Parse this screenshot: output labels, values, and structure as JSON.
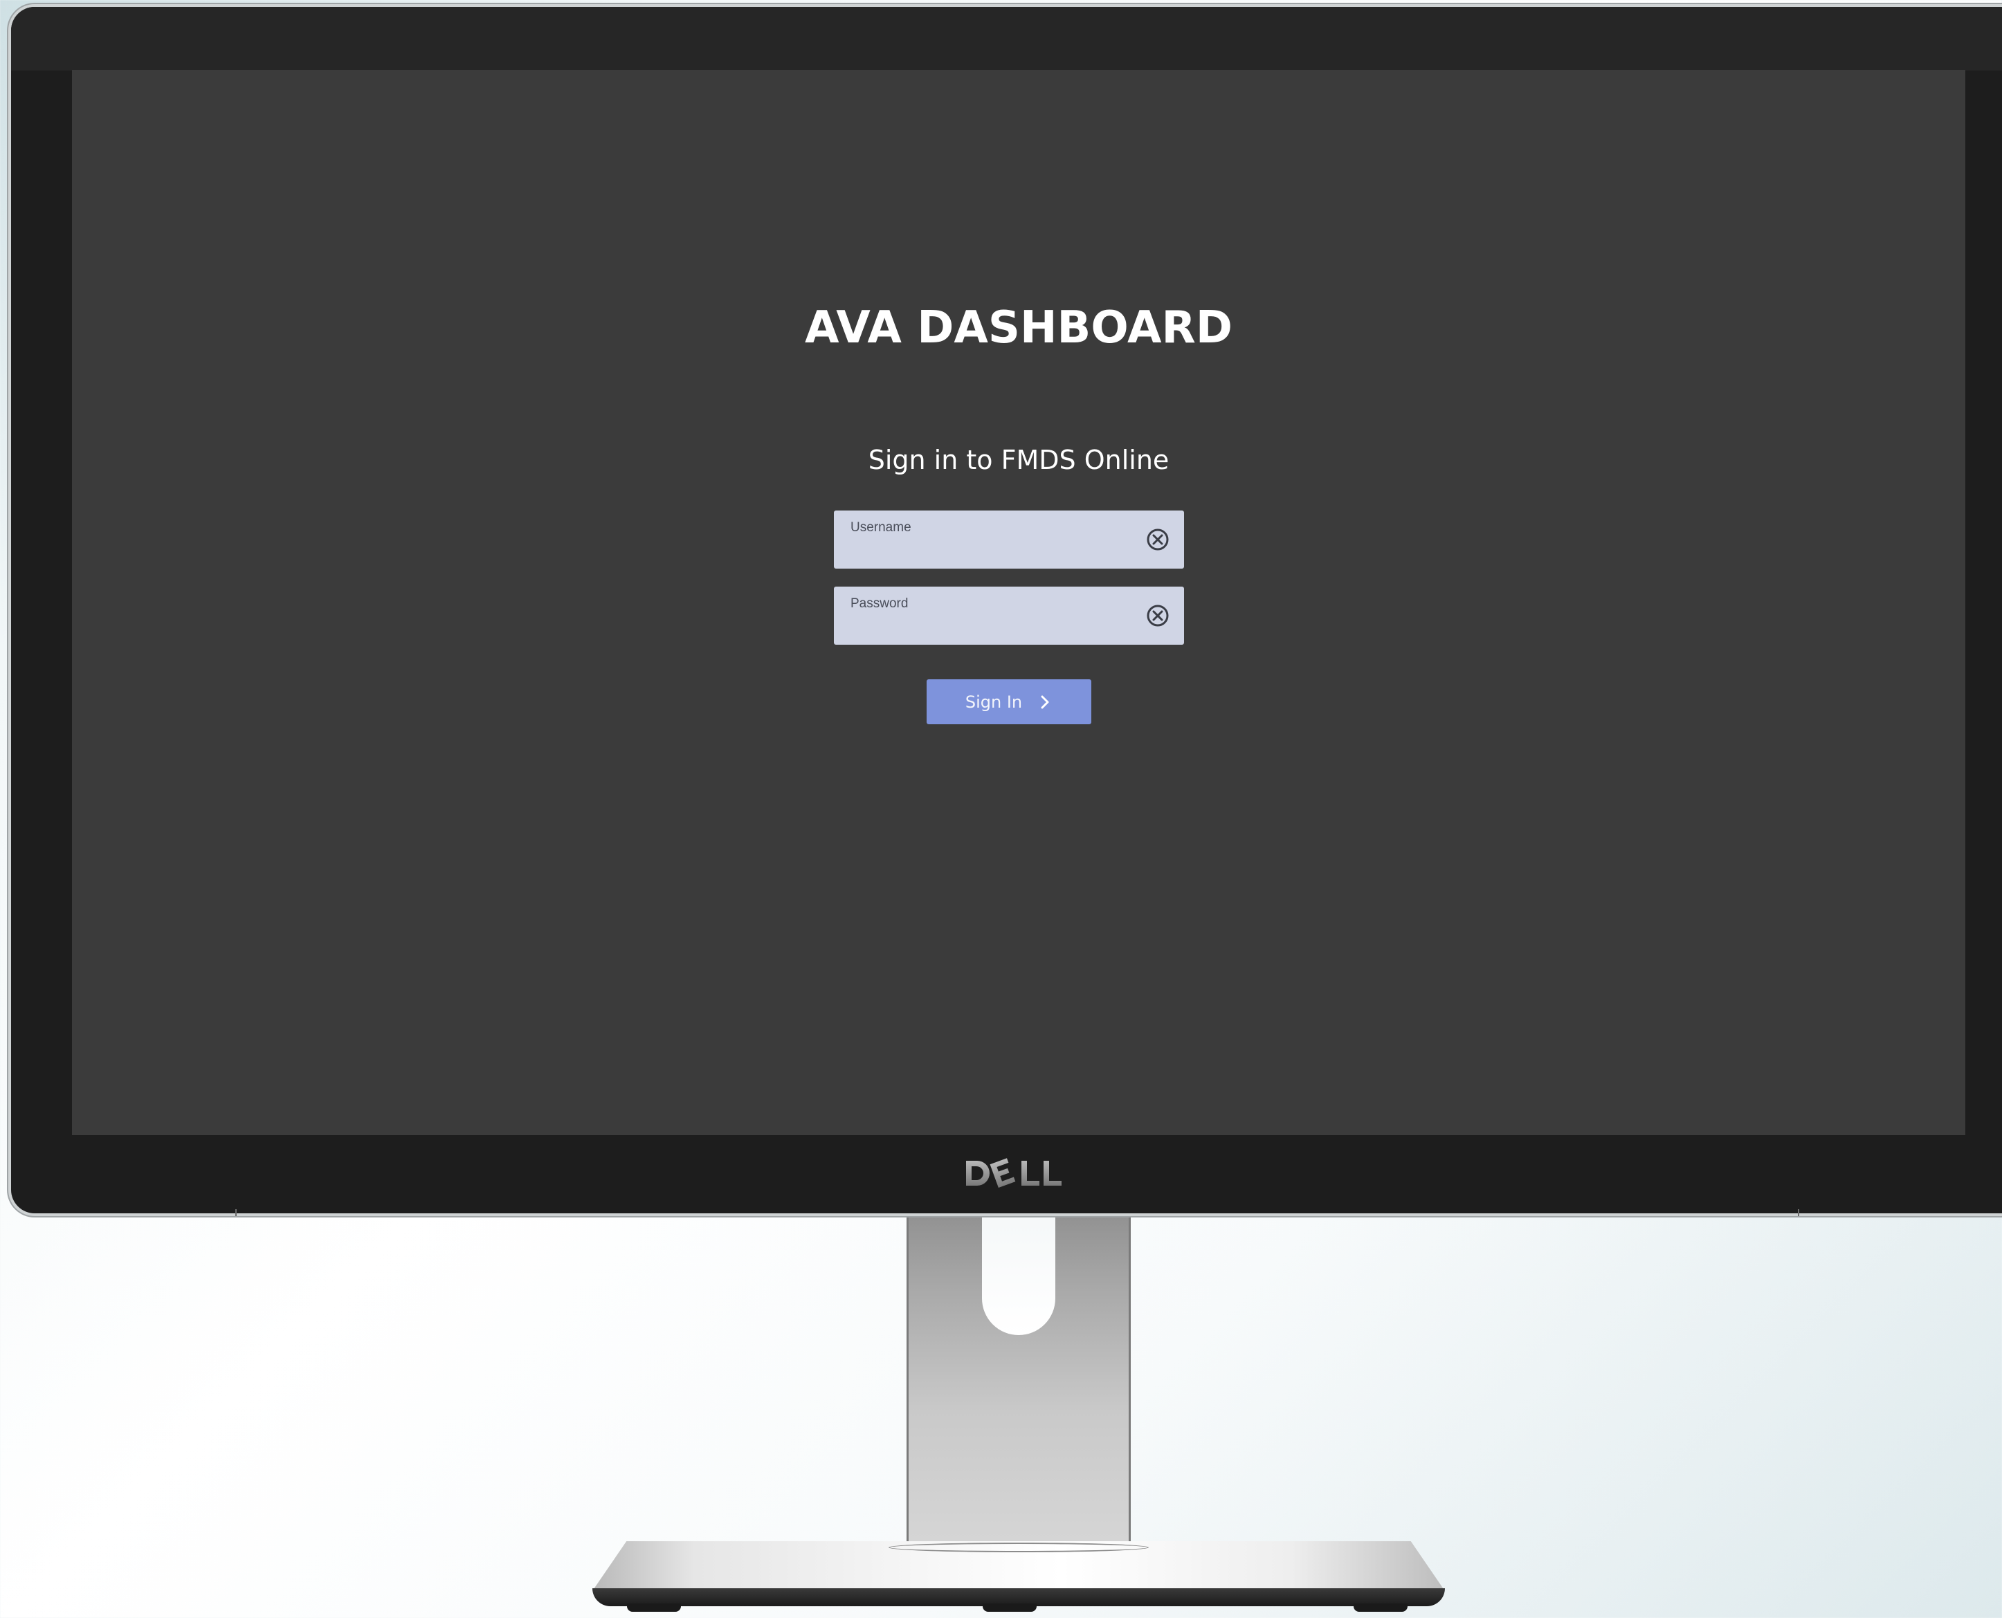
{
  "app": {
    "title": "AVA DASHBOARD",
    "subtitle": "Sign in to FMDS Online"
  },
  "form": {
    "username": {
      "label": "Username",
      "value": ""
    },
    "password": {
      "label": "Password",
      "value": ""
    },
    "submit_label": "Sign In"
  },
  "device": {
    "brand": "DELL"
  },
  "icons": {
    "clear": "clear-circle-x-icon",
    "submit": "chevron-right-icon"
  },
  "colors": {
    "screen_background": "#3b3b3b",
    "input_background": "#d0d5e5",
    "button_background": "#7e93dc",
    "bezel": "#1d1d1d"
  }
}
